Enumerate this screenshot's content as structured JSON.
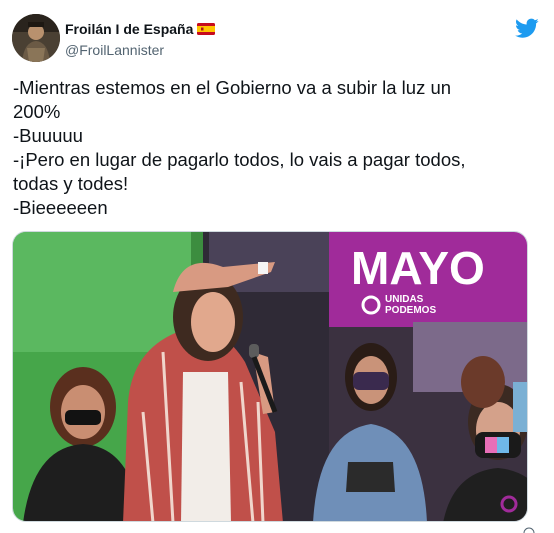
{
  "tweet": {
    "author": {
      "display_name": "Froilán I de España",
      "flag": "spain-flag-icon",
      "handle": "@FroilLannister"
    },
    "lines": [
      "-Mientras estemos en el Gobierno va a subir la luz un",
      "200%",
      "-Buuuuu",
      "-¡Pero en lugar de pagarlo todos, lo vais a pagar todos,",
      "todas y todes!",
      "-Bieeeeeen"
    ],
    "media": {
      "banner_text": "MAYO",
      "logo_text_line1": "UNIDAS",
      "logo_text_line2": "PODEMOS"
    }
  },
  "colors": {
    "brand": "#1d9bf0",
    "banner": "#a02b9a",
    "text": "#0f1419",
    "secondary": "#536471"
  }
}
